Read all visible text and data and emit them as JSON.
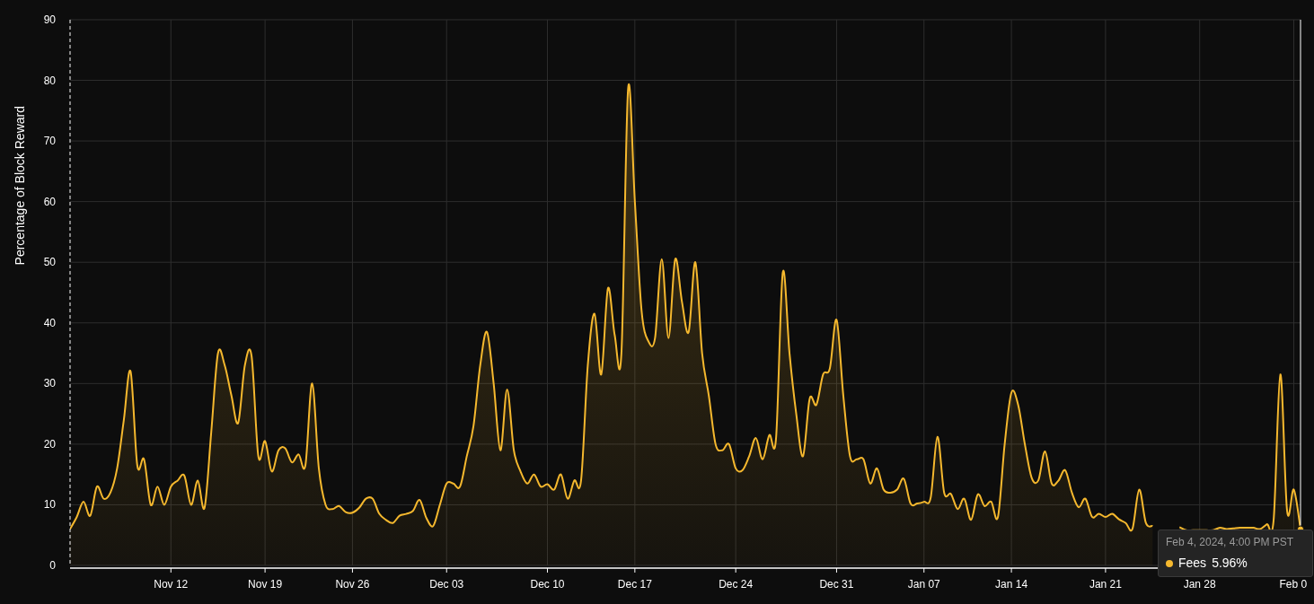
{
  "chart": {
    "chart_data": {
      "type": "area",
      "grid": true,
      "ylabel": "Percentage of Block Reward",
      "ylim": [
        0,
        90
      ],
      "yticks": [
        0,
        10,
        20,
        30,
        40,
        50,
        60,
        70,
        80,
        90
      ],
      "categories": [
        null,
        null,
        null,
        null,
        null,
        null,
        null,
        null,
        null,
        null,
        null,
        null,
        null,
        null,
        null,
        "Nov 12",
        null,
        null,
        null,
        null,
        null,
        null,
        null,
        null,
        null,
        null,
        null,
        null,
        null,
        "Nov 19",
        null,
        null,
        null,
        null,
        null,
        null,
        null,
        null,
        null,
        null,
        null,
        null,
        "Nov 26",
        null,
        null,
        null,
        null,
        null,
        null,
        null,
        null,
        null,
        null,
        null,
        null,
        null,
        "Dec 03",
        null,
        null,
        null,
        null,
        null,
        null,
        null,
        null,
        null,
        null,
        null,
        null,
        null,
        null,
        "Dec 10",
        null,
        null,
        null,
        null,
        null,
        null,
        null,
        null,
        null,
        null,
        null,
        null,
        "Dec 17",
        null,
        null,
        null,
        null,
        null,
        null,
        null,
        null,
        null,
        null,
        null,
        null,
        null,
        null,
        "Dec 24",
        null,
        null,
        null,
        null,
        null,
        null,
        null,
        null,
        null,
        null,
        null,
        null,
        null,
        null,
        "Dec 31",
        null,
        null,
        null,
        null,
        null,
        null,
        null,
        null,
        null,
        null,
        null,
        null,
        "Jan 07",
        null,
        null,
        null,
        null,
        null,
        null,
        null,
        null,
        null,
        null,
        null,
        null,
        "Jan 14",
        null,
        null,
        null,
        null,
        null,
        null,
        null,
        null,
        null,
        null,
        null,
        null,
        null,
        "Jan 21",
        null,
        null,
        null,
        null,
        null,
        null,
        null,
        null,
        null,
        null,
        null,
        null,
        null,
        "Jan 28",
        null,
        null,
        null,
        null,
        null,
        null,
        null,
        null,
        null,
        null,
        null,
        null,
        null,
        "Feb 0",
        null
      ],
      "series": [
        {
          "name": "Fees",
          "color": "#f5b82e",
          "values": [
            6,
            8,
            10.5,
            8.2,
            13,
            11,
            12,
            16,
            24,
            32,
            16.5,
            17.5,
            10,
            13,
            10,
            13,
            14,
            14.8,
            10,
            14,
            9.5,
            22,
            35,
            33,
            28,
            23.5,
            33,
            34.5,
            18,
            20.5,
            15.5,
            19,
            19.3,
            17,
            18.3,
            16.5,
            30,
            16,
            10,
            9.3,
            9.8,
            8.8,
            8.7,
            9.5,
            11,
            11,
            8.5,
            7.5,
            7,
            8.2,
            8.5,
            9,
            10.8,
            7.8,
            6.5,
            10,
            13.5,
            13.5,
            13,
            18,
            23,
            33,
            38.5,
            30,
            19,
            29,
            19,
            15.5,
            13.5,
            15,
            13,
            13.4,
            12.5,
            15,
            11,
            14,
            14,
            33,
            41.5,
            31.5,
            45.7,
            38,
            35,
            78.7,
            60,
            42,
            37,
            37.5,
            50.5,
            37.5,
            50.5,
            43.5,
            38.5,
            50,
            35,
            28,
            20,
            19,
            20,
            16,
            15.7,
            18,
            21,
            17.5,
            21.5,
            21,
            48.3,
            35,
            25,
            18,
            27.5,
            26.5,
            31.5,
            32.5,
            40.5,
            28,
            18,
            17.5,
            17.5,
            13.5,
            16,
            12.5,
            12,
            12.5,
            14.3,
            10.2,
            10.2,
            10.5,
            11.2,
            21.2,
            12,
            11.8,
            9.3,
            11,
            7.5,
            11.7,
            9.8,
            10.5,
            8,
            20,
            28.5,
            26.5,
            20,
            14.5,
            14,
            18.8,
            13.5,
            14,
            15.7,
            12,
            9.6,
            11,
            8,
            8.5,
            8,
            8.5,
            7.6,
            7,
            6,
            12.5,
            7,
            6.5,
            null,
            null,
            null,
            6.3,
            5.8,
            5.8,
            5.8,
            5.8,
            5.8,
            6.2,
            6,
            6.1,
            6.2,
            6.2,
            6.2,
            6,
            6.8,
            7.5,
            31.5,
            9,
            12.5,
            6
          ]
        }
      ]
    },
    "tooltip": {
      "title": "Feb 4, 2024, 4:00 PM PST",
      "value": "5.96%",
      "color": "#f5b82e"
    }
  }
}
